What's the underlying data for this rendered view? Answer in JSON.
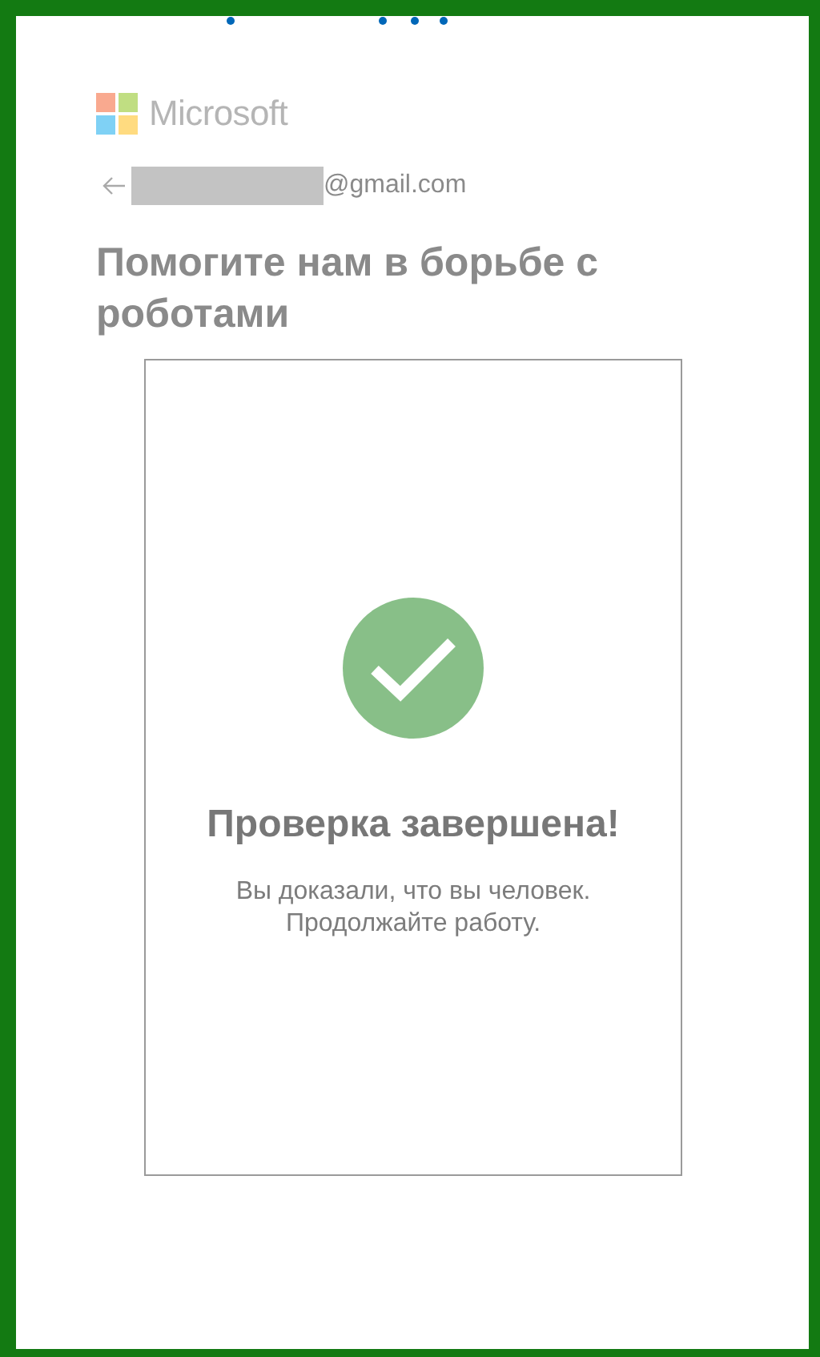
{
  "brand": {
    "name": "Microsoft"
  },
  "account": {
    "email_suffix": "@gmail.com"
  },
  "heading": "Помогите нам в борьбе с роботами",
  "challenge": {
    "verified": true,
    "title": "Проверка завершена!",
    "message_lines": [
      "Вы доказали, что вы человек.",
      "Продолжайте работу."
    ]
  }
}
